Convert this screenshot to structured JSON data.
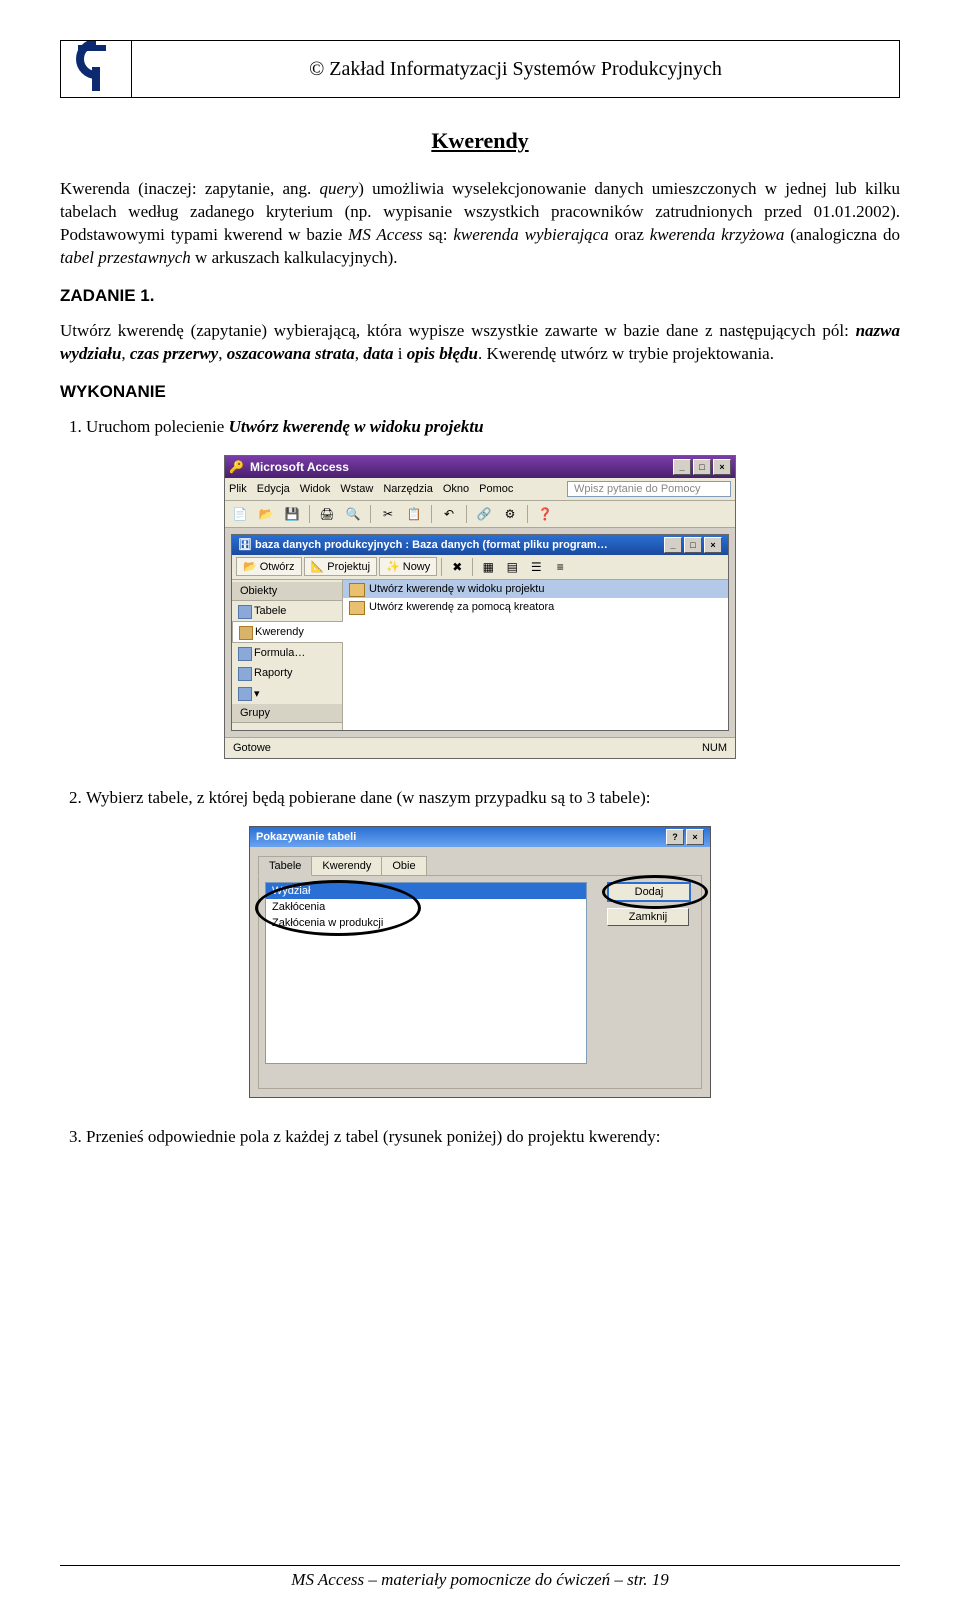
{
  "header": {
    "org": "© Zakład Informatyzacji Systemów Produkcyjnych"
  },
  "title": "Kwerendy",
  "intro_parts": {
    "p1a": "Kwerenda (inaczej: zapytanie, ang. ",
    "p1b": "query",
    "p1c": ") umożliwia wyselekcjonowanie danych umieszczonych w jednej lub kilku tabelach według zadanego kryterium (np. wypisanie wszystkich pracowników zatrudnionych przed 01.01.2002). Podstawowymi typami kwerend w bazie ",
    "p1d": "MS Access",
    "p1e": " są: ",
    "p1f": "kwerenda wybierająca",
    "p1g": " oraz ",
    "p1h": "kwerenda krzyżowa",
    "p1i": " (analogiczna do ",
    "p1j": "tabel przestawnych",
    "p1k": " w arkuszach kalkulacyjnych)."
  },
  "zadanie_h": "ZADANIE 1.",
  "zadanie_parts": {
    "a": "Utwórz kwerendę (zapytanie) wybierającą, która wypisze wszystkie zawarte w bazie dane z następujących pól: ",
    "f1": "nazwa wydziału",
    "s1": ", ",
    "f2": "czas przerwy",
    "s2": ", ",
    "f3": "oszacowana strata",
    "s3": ", ",
    "f4": "data",
    "s4": " i ",
    "f5": "opis błędu",
    "end": ". Kwerendę utwórz w trybie projektowania."
  },
  "wykonanie_h": "WYKONANIE",
  "step1_a": "Uruchom polecienie ",
  "step1_b": "Utwórz kwerendę w widoku projektu",
  "access": {
    "app_title": "Microsoft Access",
    "menu": {
      "plik": "Plik",
      "edycja": "Edycja",
      "widok": "Widok",
      "wstaw": "Wstaw",
      "narzedzia": "Narzędzia",
      "okno": "Okno",
      "pomoc": "Pomoc"
    },
    "help_placeholder": "Wpisz pytanie do Pomocy",
    "inner_title": "baza danych produkcyjnych : Baza danych (format pliku program…",
    "inner_toolbar": {
      "open": "Otwórz",
      "design": "Projektuj",
      "new": "Nowy"
    },
    "sidebar": {
      "head": "Obiekty",
      "items": [
        "Tabele",
        "Kwerendy",
        "Formula…",
        "Raporty"
      ],
      "groups": "Grupy"
    },
    "list": {
      "r1": "Utwórz kwerendę w widoku projektu",
      "r2": "Utwórz kwerendę za pomocą kreatora"
    },
    "status": {
      "left": "Gotowe",
      "right": "NUM"
    }
  },
  "step2": "Wybierz tabele, z której będą pobierane dane (w naszym przypadku są to 3 tabele):",
  "dialog": {
    "title": "Pokazywanie tabeli",
    "tabs": {
      "t1": "Tabele",
      "t2": "Kwerendy",
      "t3": "Obie"
    },
    "rows": {
      "r1": "Wydział",
      "r2": "Zakłócenia",
      "r3": "Zakłócenia w produkcji"
    },
    "btn_add": "Dodaj",
    "btn_close": "Zamknij"
  },
  "step3": "Przenieś odpowiednie pola z każdej z tabel (rysunek poniżej) do projektu kwerendy:",
  "footer_a": "MS Access",
  "footer_b": " – materiały pomocnicze do ćwiczeń – str. 19"
}
